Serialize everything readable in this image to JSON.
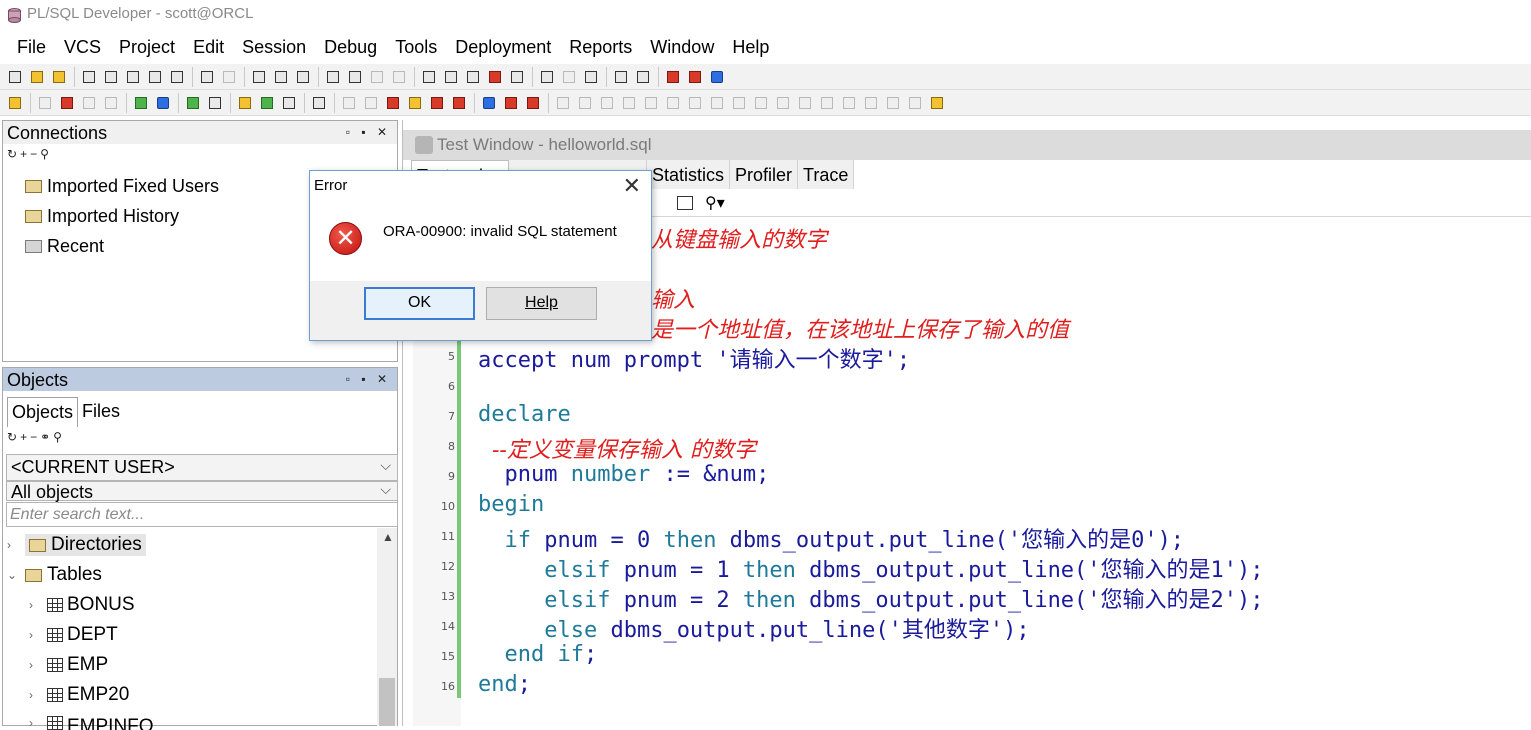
{
  "window": {
    "title": "PL/SQL Developer - scott@ORCL"
  },
  "menu": [
    "File",
    "VCS",
    "Project",
    "Edit",
    "Session",
    "Debug",
    "Tools",
    "Deployment",
    "Reports",
    "Window",
    "Help"
  ],
  "connections": {
    "title": "Connections",
    "items": [
      "Imported Fixed Users",
      "Imported History",
      "Recent"
    ]
  },
  "objects": {
    "title": "Objects",
    "tabs": [
      "Objects",
      "Files"
    ],
    "user_combo": "<CURRENT USER>",
    "filter_combo": "All objects",
    "search_placeholder": "Enter search text...",
    "tree": [
      "Directories",
      "Tables",
      "BONUS",
      "DEPT",
      "EMP",
      "EMP20",
      "EMPINFO"
    ]
  },
  "test_window": {
    "title": "Test Window - helloworld.sql",
    "tabs": [
      "Test script",
      "Statistics",
      "Profiler",
      "Trace"
    ],
    "tab_partial": "Test scri",
    "lines": [
      {
        "n": "",
        "comment": "从键盘输入的数字"
      },
      {
        "n": "",
        "comment": "输入"
      },
      {
        "n": "",
        "comment": "是一个地址值，在该地址上保存了输入的值"
      },
      {
        "n": "5",
        "code": "accept num prompt '请输入一个数字';"
      },
      {
        "n": "6",
        "code": ""
      },
      {
        "n": "7",
        "kw": "declare"
      },
      {
        "n": "8",
        "comment": "  --定义变量保存输入 的数字"
      },
      {
        "n": "9",
        "code": "  pnum ",
        "kw2": "number",
        "rest": " := &num;"
      },
      {
        "n": "10",
        "kw": "begin"
      },
      {
        "n": "11",
        "code": "  ",
        "kw2": "if",
        "rest": " pnum = 0 ",
        "kw3": "then",
        "rest2": " dbms_output.put_line('您输入的是0');"
      },
      {
        "n": "12",
        "code": "     ",
        "kw2": "elsif",
        "rest": " pnum = 1 ",
        "kw3": "then",
        "rest2": " dbms_output.put_line('您输入的是1');"
      },
      {
        "n": "13",
        "code": "     ",
        "kw2": "elsif",
        "rest": " pnum = 2 ",
        "kw3": "then",
        "rest2": " dbms_output.put_line('您输入的是2');"
      },
      {
        "n": "14",
        "code": "     ",
        "kw2": "else",
        "rest": " dbms_output.put_line('其他数字');"
      },
      {
        "n": "15",
        "code": "  ",
        "kw2": "end if",
        "rest": ";"
      },
      {
        "n": "16",
        "kw": "end",
        "rest": ";"
      }
    ]
  },
  "error_dialog": {
    "title": "Error",
    "message": "ORA-00900: invalid SQL statement",
    "ok": "OK",
    "help": "Help"
  }
}
